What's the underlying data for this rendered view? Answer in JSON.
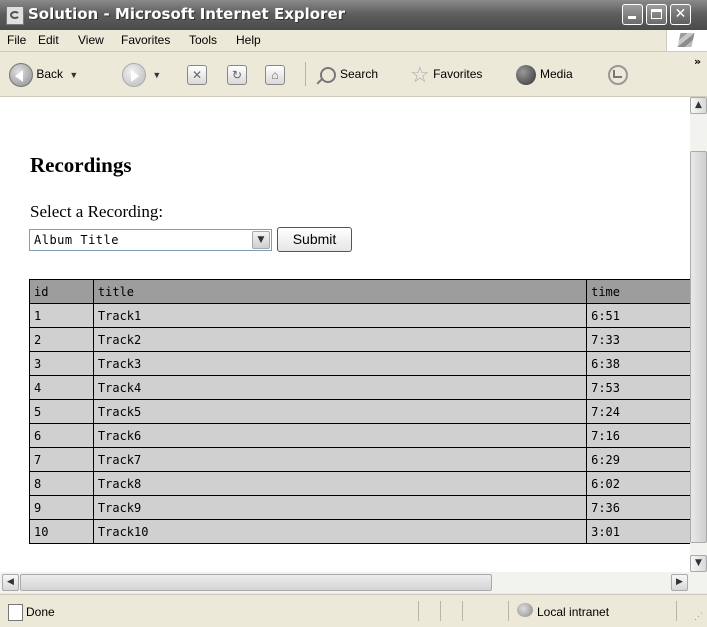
{
  "window": {
    "title": "Solution - Microsoft Internet Explorer"
  },
  "menu": [
    "File",
    "Edit",
    "View",
    "Favorites",
    "Tools",
    "Help"
  ],
  "toolbar": {
    "back": "Back",
    "search": "Search",
    "favorites": "Favorites",
    "media": "Media"
  },
  "page": {
    "heading": "Recordings",
    "select_label": "Select a Recording:",
    "select_value": "Album Title",
    "submit_label": "Submit",
    "table": {
      "headers": [
        "id",
        "title",
        "time"
      ],
      "rows": [
        [
          "1",
          "Track1",
          "6:51"
        ],
        [
          "2",
          "Track2",
          "7:33"
        ],
        [
          "3",
          "Track3",
          "6:38"
        ],
        [
          "4",
          "Track4",
          "7:53"
        ],
        [
          "5",
          "Track5",
          "7:24"
        ],
        [
          "6",
          "Track6",
          "7:16"
        ],
        [
          "7",
          "Track7",
          "6:29"
        ],
        [
          "8",
          "Track8",
          "6:02"
        ],
        [
          "9",
          "Track9",
          "7:36"
        ],
        [
          "10",
          "Track10",
          "3:01"
        ]
      ]
    }
  },
  "status": {
    "text": "Done",
    "zone": "Local intranet"
  }
}
